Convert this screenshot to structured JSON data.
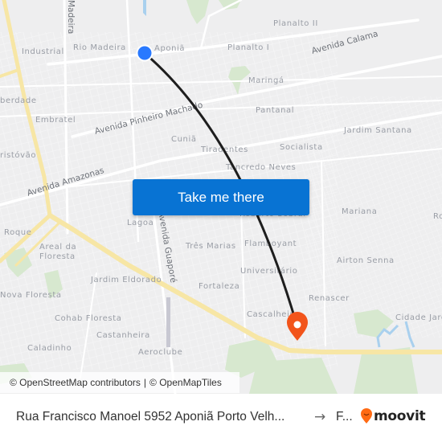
{
  "map": {
    "neighborhoods": [
      {
        "name": "Industrial",
        "key": "industrial"
      },
      {
        "name": "Rio Madeira",
        "key": "rio-madeira"
      },
      {
        "name": "Aponiã",
        "key": "aponia"
      },
      {
        "name": "Planalto II",
        "key": "planalto-ii"
      },
      {
        "name": "Planalto I",
        "key": "planalto-i"
      },
      {
        "name": "Maringá",
        "key": "maringa"
      },
      {
        "name": "Pantanal",
        "key": "pantanal"
      },
      {
        "name": "berdade",
        "key": "liberdade"
      },
      {
        "name": "Embratel",
        "key": "embratel"
      },
      {
        "name": "Cuniã",
        "key": "cunia"
      },
      {
        "name": "Jardim Santana",
        "key": "jardim-santana"
      },
      {
        "name": "ristóvão",
        "key": "sao-cristovao"
      },
      {
        "name": "Tiradentes",
        "key": "tiradentes"
      },
      {
        "name": "Socialista",
        "key": "socialista"
      },
      {
        "name": "Tancredo Neves",
        "key": "tancredo-neves"
      },
      {
        "name": "Roberto Sobral",
        "key": "roberto-sobral"
      },
      {
        "name": "Mariana",
        "key": "mariana"
      },
      {
        "name": "Ro",
        "key": "ro-east"
      },
      {
        "name": "Lagoa",
        "key": "lagoa"
      },
      {
        "name": "Roque",
        "key": "roque"
      },
      {
        "name": "Areal da",
        "key": "areal-1"
      },
      {
        "name": "Floresta",
        "key": "areal-2"
      },
      {
        "name": "Três Marias",
        "key": "tres-marias"
      },
      {
        "name": "Flamboyant",
        "key": "flamboyant"
      },
      {
        "name": "Airton Senna",
        "key": "airton-senna"
      },
      {
        "name": "Universitário",
        "key": "universitario"
      },
      {
        "name": "Jardim Eldorado",
        "key": "jardim-eldorado"
      },
      {
        "name": "Nova Floresta",
        "key": "nova-floresta"
      },
      {
        "name": "Fortaleza",
        "key": "fortaleza"
      },
      {
        "name": "Renascer",
        "key": "renascer"
      },
      {
        "name": "Cohab Floresta",
        "key": "cohab-floresta"
      },
      {
        "name": "Cascalheira",
        "key": "cascalheira"
      },
      {
        "name": "Cidade Jardim",
        "key": "cidade-jardim"
      },
      {
        "name": "Castanheira",
        "key": "castanheira"
      },
      {
        "name": "Caladinho",
        "key": "caladinho"
      },
      {
        "name": "Aeroclube",
        "key": "aeroclube"
      }
    ],
    "streets": [
      {
        "name": "Madeira",
        "key": "madeira"
      },
      {
        "name": "Avenida Calama",
        "key": "avenida-calama"
      },
      {
        "name": "Avenida Pinheiro Machado",
        "key": "avenida-pinheiro-machado"
      },
      {
        "name": "Avenida Amazonas",
        "key": "avenida-amazonas"
      },
      {
        "name": "Avenida Guaporé",
        "key": "avenida-guapore"
      }
    ],
    "origin_marker_color": "#2979ff",
    "destination_marker_color": "#f2541b",
    "route_line_color": "#1e1e1e"
  },
  "cta": {
    "label": "Take me there",
    "color": "#0873d3"
  },
  "attribution": {
    "osm": "© OpenStreetMap contributors",
    "separator": "|",
    "omt": "© OpenMapTiles"
  },
  "footer": {
    "origin": "Rua Francisco Manoel 5952 Aponiã Porto Velh...",
    "arrow_icon": "→",
    "destination": "F...",
    "brand": "moovit",
    "brand_color": "#ff6a13"
  }
}
